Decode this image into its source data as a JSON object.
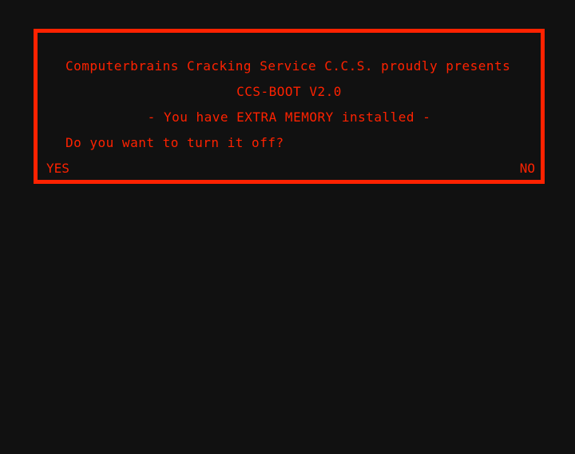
{
  "dialog": {
    "intro_line": "Computerbrains Cracking Service C.C.S. proudly presents",
    "title_line": "CCS-BOOT V2.0",
    "info_line": "- You have EXTRA MEMORY installed -",
    "question_line": "Do you want to turn it off?",
    "yes_label": "YES",
    "no_label": "NO"
  },
  "colors": {
    "background": "#111111",
    "accent": "#ff2200"
  }
}
